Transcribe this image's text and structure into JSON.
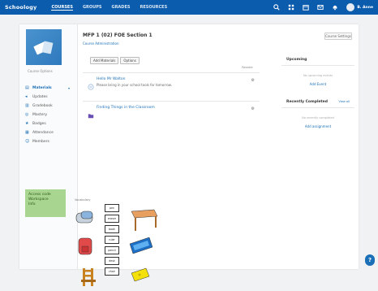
{
  "app": {
    "logo_text": "Schoology",
    "user_label": "B. Anne"
  },
  "nav": [
    {
      "label": "COURSES",
      "active": true
    },
    {
      "label": "GROUPS",
      "active": false
    },
    {
      "label": "GRADES",
      "active": false
    },
    {
      "label": "RESOURCES",
      "active": false
    }
  ],
  "top_icons": [
    "search-icon",
    "apps-icon",
    "calendar-icon",
    "messages-icon",
    "notifications-icon"
  ],
  "sidebar": {
    "edit_label": "Course Options",
    "items": [
      {
        "label": "Materials",
        "active": true,
        "icon": "folder-icon"
      },
      {
        "label": "Updates",
        "active": false,
        "icon": "megaphone-icon"
      },
      {
        "label": "Gradebook",
        "active": false,
        "icon": "book-icon"
      },
      {
        "label": "Mastery",
        "active": false,
        "icon": "target-icon"
      },
      {
        "label": "Badges",
        "active": false,
        "icon": "badge-icon"
      },
      {
        "label": "Attendance",
        "active": false,
        "icon": "calendar-icon"
      },
      {
        "label": "Members",
        "active": false,
        "icon": "people-icon"
      }
    ],
    "promo_lines": [
      "Access code",
      "Workspace",
      "Info"
    ]
  },
  "course": {
    "title": "MFP 1 (02) FOE Section 1",
    "subtitle": "Course Administration",
    "settings_button": "Course Settings"
  },
  "content": {
    "filter_1": "Add Materials",
    "filter_2": "Options",
    "sort_label": "Reorder",
    "posts": [
      {
        "title": "Hello Mr Walton",
        "body": "Please bring in your school tools for tomorrow.",
        "icon": "note-icon"
      },
      {
        "title": "Finding Things in the Classroom",
        "body": "",
        "icon": "folder-icon"
      }
    ]
  },
  "worksheet": {
    "label": "Vocabulary",
    "words": [
      "pen",
      "eraser",
      "book",
      "ruler",
      "pencil",
      "desk",
      "chair"
    ]
  },
  "right_panel": {
    "upcoming_title": "Upcoming",
    "upcoming_empty": "No upcoming events",
    "upcoming_link": "Add Event",
    "recent_title": "Recently Completed",
    "recent_more": "View all",
    "recent_empty": "No recently completed",
    "recent_link": "Add assignment"
  },
  "help_label": "?"
}
